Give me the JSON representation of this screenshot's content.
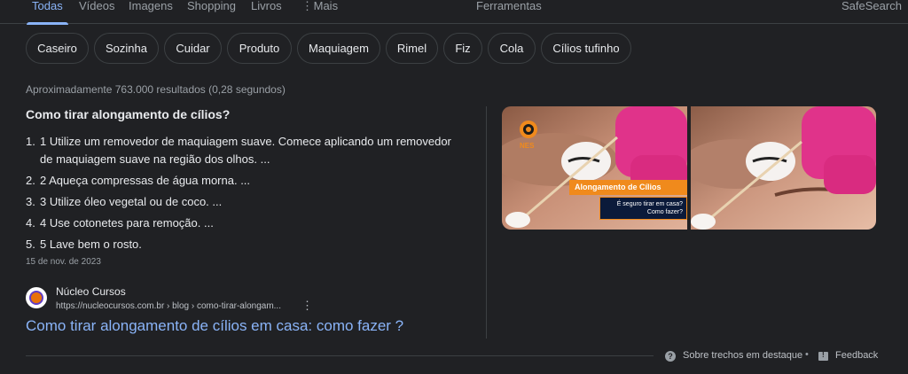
{
  "nav": {
    "tabs": [
      "Todas",
      "Vídeos",
      "Imagens",
      "Shopping",
      "Livros"
    ],
    "more_label": "Mais",
    "tools_label": "Ferramentas",
    "safesearch_label": "SafeSearch"
  },
  "chips": [
    "Caseiro",
    "Sozinha",
    "Cuidar",
    "Produto",
    "Maquiagem",
    "Rimel",
    "Fiz",
    "Cola",
    "Cílios tufinho"
  ],
  "stats": "Aproximadamente 763.000 resultados (0,28 segundos)",
  "snippet": {
    "question": "Como tirar alongamento de cílios?",
    "steps": [
      {
        "num": "1.",
        "text": "1 Utilize um removedor de maquiagem suave. Comece aplicando um removedor de maquiagem suave na região dos olhos. ..."
      },
      {
        "num": "2.",
        "text": "2 Aqueça compressas de água morna. ..."
      },
      {
        "num": "3.",
        "text": "3 Utilize óleo vegetal ou de coco. ..."
      },
      {
        "num": "4.",
        "text": "4 Use cotonetes para remoção. ..."
      },
      {
        "num": "5.",
        "text": "5 Lave bem o rosto."
      }
    ],
    "date": "15 de nov. de 2023"
  },
  "source": {
    "site_name": "Núcleo Cursos",
    "url": "https://nucleocursos.com.br › blog › como-tirar-alongam...",
    "menu_icon": "more-vert-icon",
    "title": "Como tirar alongamento de cílios em casa: como fazer ?"
  },
  "image": {
    "logo_text": "NES",
    "banner_title": "Alongamento de Cílios",
    "banner_sub_1": "É seguro tirar em casa?",
    "banner_sub_2": "Como fazer?"
  },
  "footer": {
    "about_label": "Sobre trechos em destaque",
    "feedback_label": "Feedback"
  },
  "colors": {
    "background": "#202124",
    "link": "#8ab4f8",
    "accent_orange": "#f08a1c"
  }
}
